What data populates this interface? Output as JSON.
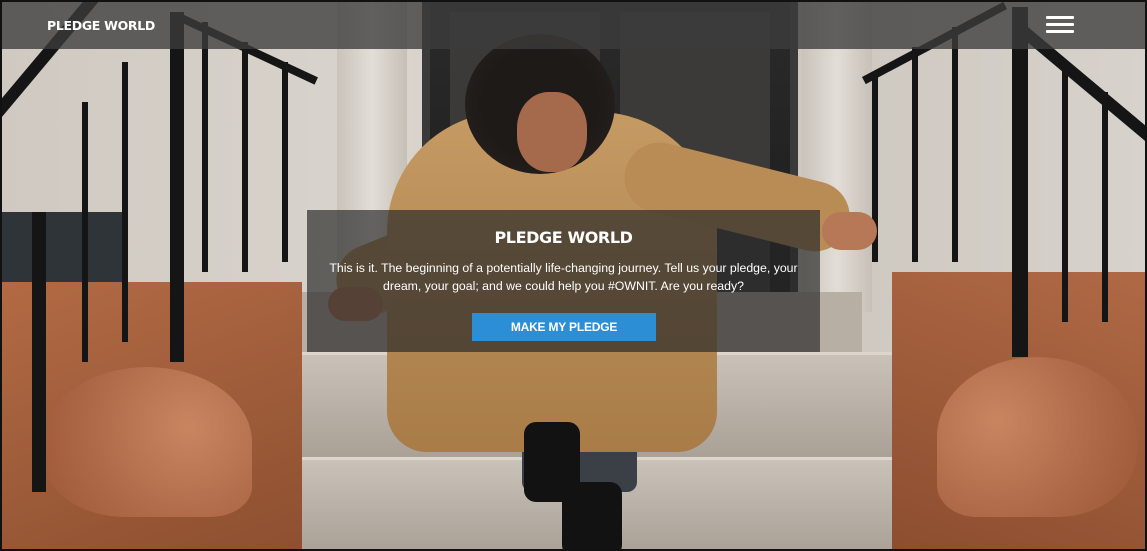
{
  "header": {
    "brand": "PLEDGE WORLD",
    "menu_icon": "hamburger-menu-icon"
  },
  "hero": {
    "title": "PLEDGE WORLD",
    "description": "This is it. The beginning of a potentially life-changing journey. Tell us your pledge, your dream, your goal; and we could help you #OWNIT. Are you ready?",
    "cta_label": "MAKE MY PLEDGE"
  },
  "colors": {
    "cta_background": "#2c8fd6",
    "header_overlay": "rgba(60,60,60,0.78)",
    "hero_overlay": "rgba(40,40,40,0.68)"
  }
}
